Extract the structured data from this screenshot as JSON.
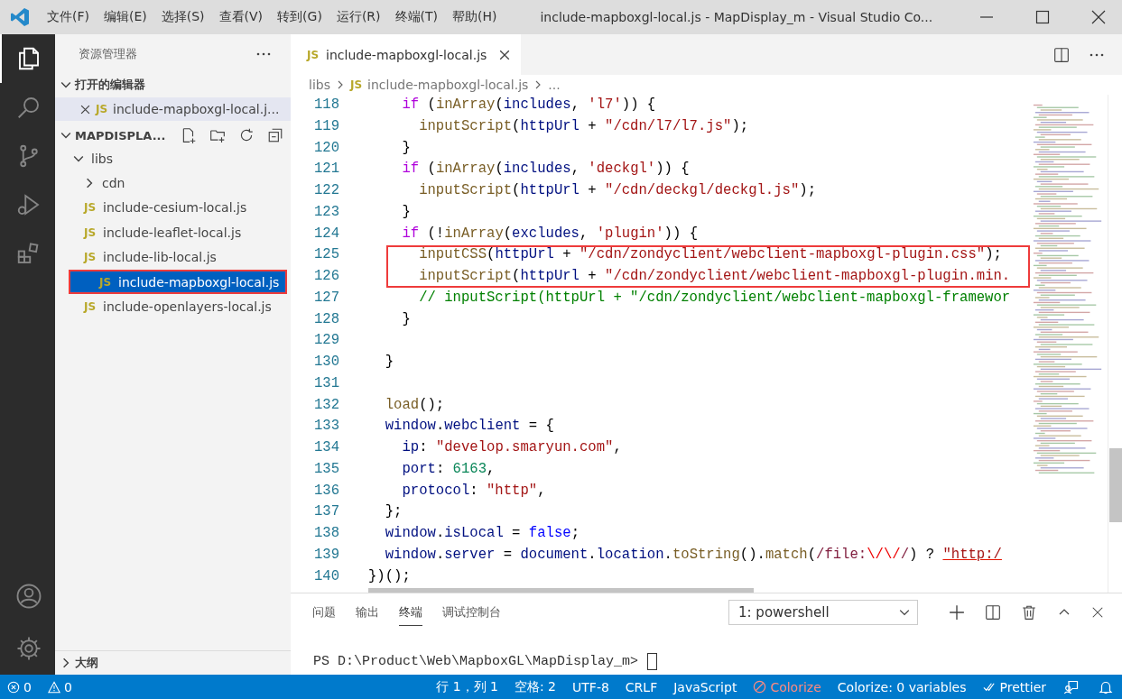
{
  "title_bar": {
    "menus": [
      "文件(F)",
      "编辑(E)",
      "选择(S)",
      "查看(V)",
      "转到(G)",
      "运行(R)",
      "终端(T)",
      "帮助(H)"
    ],
    "title": "include-mapboxgl-local.js - MapDisplay_m - Visual Studio Co..."
  },
  "activity_bar": {
    "items": [
      {
        "kind": "explorer",
        "selected": true
      },
      {
        "kind": "search",
        "selected": false
      },
      {
        "kind": "source-control",
        "selected": false
      },
      {
        "kind": "run",
        "selected": false
      },
      {
        "kind": "extensions",
        "selected": false
      }
    ],
    "bottom": [
      {
        "kind": "account"
      },
      {
        "kind": "settings"
      }
    ]
  },
  "sidebar": {
    "title": "资源管理器",
    "open_editors": {
      "label": "打开的编辑器",
      "expanded": true,
      "items": [
        {
          "name": "include-mapboxgl-local.j...",
          "badge": "JS"
        }
      ]
    },
    "folder": {
      "label": "MAPDISPLA...",
      "expanded": true,
      "tree": [
        {
          "name": "libs",
          "kind": "folder",
          "expanded": true,
          "children": [
            {
              "name": "cdn",
              "kind": "folder",
              "expanded": false
            },
            {
              "name": "include-cesium-local.js",
              "kind": "file",
              "badge": "JS",
              "selected": false,
              "annotated": false
            },
            {
              "name": "include-leaflet-local.js",
              "kind": "file",
              "badge": "JS",
              "selected": false,
              "annotated": false
            },
            {
              "name": "include-lib-local.js",
              "kind": "file",
              "badge": "JS",
              "selected": false,
              "annotated": false
            },
            {
              "name": "include-mapboxgl-local.js",
              "kind": "file",
              "badge": "JS",
              "selected": true,
              "annotated": true
            },
            {
              "name": "include-openlayers-local.js",
              "kind": "file",
              "badge": "JS",
              "selected": false,
              "annotated": false
            }
          ]
        }
      ]
    },
    "outline": {
      "label": "大纲",
      "expanded": false
    }
  },
  "editor": {
    "tabs": [
      {
        "label": "include-mapboxgl-local.js",
        "badge": "JS",
        "selected": true
      }
    ],
    "breadcrumb": [
      {
        "text": "libs"
      },
      {
        "text": "include-mapboxgl-local.js",
        "badge": "JS"
      },
      {
        "text": "..."
      }
    ],
    "lines": [
      {
        "number": "118",
        "tokens": [
          {
            "text": "    if",
            "kind": "keyword"
          },
          {
            "text": " (",
            "kind": "plain"
          },
          {
            "text": "inArray",
            "kind": "function"
          },
          {
            "text": "(",
            "kind": "plain"
          },
          {
            "text": "includes",
            "kind": "variable"
          },
          {
            "text": ", ",
            "kind": "plain"
          },
          {
            "text": "'l7'",
            "kind": "string"
          },
          {
            "text": ")) {",
            "kind": "plain"
          }
        ]
      },
      {
        "number": "119",
        "tokens": [
          {
            "text": "      inputScript",
            "kind": "function"
          },
          {
            "text": "(",
            "kind": "plain"
          },
          {
            "text": "httpUrl",
            "kind": "variable"
          },
          {
            "text": " + ",
            "kind": "plain"
          },
          {
            "text": "\"/cdn/l7/l7.js\"",
            "kind": "string"
          },
          {
            "text": ");",
            "kind": "plain"
          }
        ]
      },
      {
        "number": "120",
        "tokens": [
          {
            "text": "    }",
            "kind": "plain"
          }
        ]
      },
      {
        "number": "121",
        "tokens": [
          {
            "text": "    if",
            "kind": "keyword"
          },
          {
            "text": " (",
            "kind": "plain"
          },
          {
            "text": "inArray",
            "kind": "function"
          },
          {
            "text": "(",
            "kind": "plain"
          },
          {
            "text": "includes",
            "kind": "variable"
          },
          {
            "text": ", ",
            "kind": "plain"
          },
          {
            "text": "'deckgl'",
            "kind": "string"
          },
          {
            "text": ")) {",
            "kind": "plain"
          }
        ]
      },
      {
        "number": "122",
        "tokens": [
          {
            "text": "      inputScript",
            "kind": "function"
          },
          {
            "text": "(",
            "kind": "plain"
          },
          {
            "text": "httpUrl",
            "kind": "variable"
          },
          {
            "text": " + ",
            "kind": "plain"
          },
          {
            "text": "\"/cdn/deckgl/deckgl.js\"",
            "kind": "string"
          },
          {
            "text": ");",
            "kind": "plain"
          }
        ]
      },
      {
        "number": "123",
        "tokens": [
          {
            "text": "    }",
            "kind": "plain"
          }
        ]
      },
      {
        "number": "124",
        "tokens": [
          {
            "text": "    if",
            "kind": "keyword"
          },
          {
            "text": " (!",
            "kind": "plain"
          },
          {
            "text": "inArray",
            "kind": "function"
          },
          {
            "text": "(",
            "kind": "plain"
          },
          {
            "text": "excludes",
            "kind": "variable"
          },
          {
            "text": ", ",
            "kind": "plain"
          },
          {
            "text": "'plugin'",
            "kind": "string"
          },
          {
            "text": ")) {",
            "kind": "plain"
          }
        ]
      },
      {
        "number": "125",
        "annotated": true,
        "tokens": [
          {
            "text": "      inputCSS",
            "kind": "function"
          },
          {
            "text": "(",
            "kind": "plain"
          },
          {
            "text": "httpUrl",
            "kind": "variable"
          },
          {
            "text": " + ",
            "kind": "plain"
          },
          {
            "text": "\"/cdn/zondyclient/webclient-mapboxgl-plugin.css\"",
            "kind": "string"
          },
          {
            "text": ");",
            "kind": "plain"
          }
        ]
      },
      {
        "number": "126",
        "annotated": true,
        "tokens": [
          {
            "text": "      inputScript",
            "kind": "function"
          },
          {
            "text": "(",
            "kind": "plain"
          },
          {
            "text": "httpUrl",
            "kind": "variable"
          },
          {
            "text": " + ",
            "kind": "plain"
          },
          {
            "text": "\"/cdn/zondyclient/webclient-mapboxgl-plugin.min.",
            "kind": "string"
          }
        ]
      },
      {
        "number": "127",
        "tokens": [
          {
            "text": "      // inputScript(httpUrl + \"/cdn/zondyclient/webclient-mapboxgl-framewor",
            "kind": "comment"
          }
        ]
      },
      {
        "number": "128",
        "tokens": [
          {
            "text": "    }",
            "kind": "plain"
          }
        ]
      },
      {
        "number": "129"
      },
      {
        "number": "130",
        "tokens": [
          {
            "text": "  }",
            "kind": "plain"
          }
        ]
      },
      {
        "number": "131"
      },
      {
        "number": "132",
        "tokens": [
          {
            "text": "  load",
            "kind": "function"
          },
          {
            "text": "();",
            "kind": "plain"
          }
        ]
      },
      {
        "number": "133",
        "tokens": [
          {
            "text": "  window",
            "kind": "variable"
          },
          {
            "text": ".",
            "kind": "plain"
          },
          {
            "text": "webclient",
            "kind": "variable"
          },
          {
            "text": " = {",
            "kind": "plain"
          }
        ]
      },
      {
        "number": "134",
        "tokens": [
          {
            "text": "    ip",
            "kind": "variable"
          },
          {
            "text": ": ",
            "kind": "plain"
          },
          {
            "text": "\"develop.smaryun.com\"",
            "kind": "string"
          },
          {
            "text": ",",
            "kind": "plain"
          }
        ]
      },
      {
        "number": "135",
        "tokens": [
          {
            "text": "    port",
            "kind": "variable"
          },
          {
            "text": ": ",
            "kind": "plain"
          },
          {
            "text": "6163",
            "kind": "number"
          },
          {
            "text": ",",
            "kind": "plain"
          }
        ]
      },
      {
        "number": "136",
        "tokens": [
          {
            "text": "    protocol",
            "kind": "variable"
          },
          {
            "text": ": ",
            "kind": "plain"
          },
          {
            "text": "\"http\"",
            "kind": "string"
          },
          {
            "text": ",",
            "kind": "plain"
          }
        ]
      },
      {
        "number": "137",
        "tokens": [
          {
            "text": "  };",
            "kind": "plain"
          }
        ]
      },
      {
        "number": "138",
        "tokens": [
          {
            "text": "  window",
            "kind": "variable"
          },
          {
            "text": ".",
            "kind": "plain"
          },
          {
            "text": "isLocal",
            "kind": "variable"
          },
          {
            "text": " = ",
            "kind": "plain"
          },
          {
            "text": "false",
            "kind": "boolean"
          },
          {
            "text": ";",
            "kind": "plain"
          }
        ]
      },
      {
        "number": "139",
        "tokens": [
          {
            "text": "  window",
            "kind": "variable"
          },
          {
            "text": ".",
            "kind": "plain"
          },
          {
            "text": "server",
            "kind": "variable"
          },
          {
            "text": " = ",
            "kind": "plain"
          },
          {
            "text": "document",
            "kind": "variable"
          },
          {
            "text": ".",
            "kind": "plain"
          },
          {
            "text": "location",
            "kind": "variable"
          },
          {
            "text": ".",
            "kind": "plain"
          },
          {
            "text": "toString",
            "kind": "function"
          },
          {
            "text": "().",
            "kind": "plain"
          },
          {
            "text": "match",
            "kind": "function"
          },
          {
            "text": "(",
            "kind": "plain"
          },
          {
            "text": "/file:",
            "kind": "regex"
          },
          {
            "text": "\\/\\/",
            "kind": "escape"
          },
          {
            "text": "/",
            "kind": "regex"
          },
          {
            "text": ") ? ",
            "kind": "plain"
          },
          {
            "text": "\"http:/",
            "kind": "link"
          }
        ]
      },
      {
        "number": "140",
        "tokens": [
          {
            "text": "})();",
            "kind": "plain"
          }
        ]
      }
    ]
  },
  "panel": {
    "tabs": [
      {
        "label": "问题",
        "selected": false
      },
      {
        "label": "输出",
        "selected": false
      },
      {
        "label": "终端",
        "selected": true
      },
      {
        "label": "调试控制台",
        "selected": false
      }
    ],
    "terminal_select": {
      "value": "1: powershell"
    },
    "terminal_lines": [
      "PS D:\\Product\\Web\\MapboxGL\\MapDisplay_m>"
    ]
  },
  "status_bar": {
    "left": [
      {
        "kind": "errors",
        "text": "0"
      },
      {
        "kind": "warnings",
        "text": "0"
      }
    ],
    "right": [
      {
        "kind": "text",
        "text": "行 1，列 1"
      },
      {
        "kind": "text",
        "text": "空格: 2"
      },
      {
        "kind": "text",
        "text": "UTF-8"
      },
      {
        "kind": "text",
        "text": "CRLF"
      },
      {
        "kind": "text",
        "text": "JavaScript"
      },
      {
        "kind": "colorize",
        "text": "Colorize"
      },
      {
        "kind": "text",
        "text": "Colorize: 0 variables"
      },
      {
        "kind": "prettier",
        "text": "Prettier"
      },
      {
        "kind": "feedback"
      },
      {
        "kind": "bell"
      }
    ]
  }
}
